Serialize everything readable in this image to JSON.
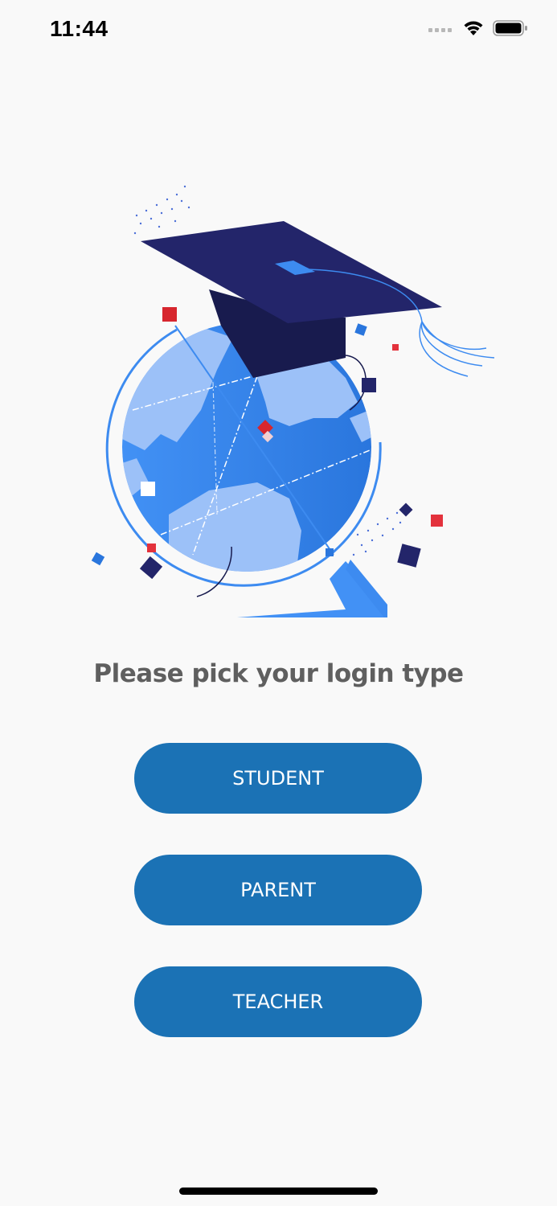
{
  "status_bar": {
    "time": "11:44"
  },
  "prompt": {
    "text": "Please pick your login type"
  },
  "login_types": {
    "student": "STUDENT",
    "parent": "PARENT",
    "teacher": "TEACHER"
  },
  "colors": {
    "background": "#f9f9f9",
    "button": "#1b72b5",
    "button_text": "#ffffff",
    "prompt_text": "#5f5f5f",
    "globe_blue": "#3d8bf0",
    "cap_navy": "#23256a",
    "accent_red": "#e3323c"
  },
  "icons": {
    "signal": "cellular-signal-icon",
    "wifi": "wifi-icon",
    "battery": "battery-icon",
    "illustration": "graduation-globe-illustration"
  }
}
